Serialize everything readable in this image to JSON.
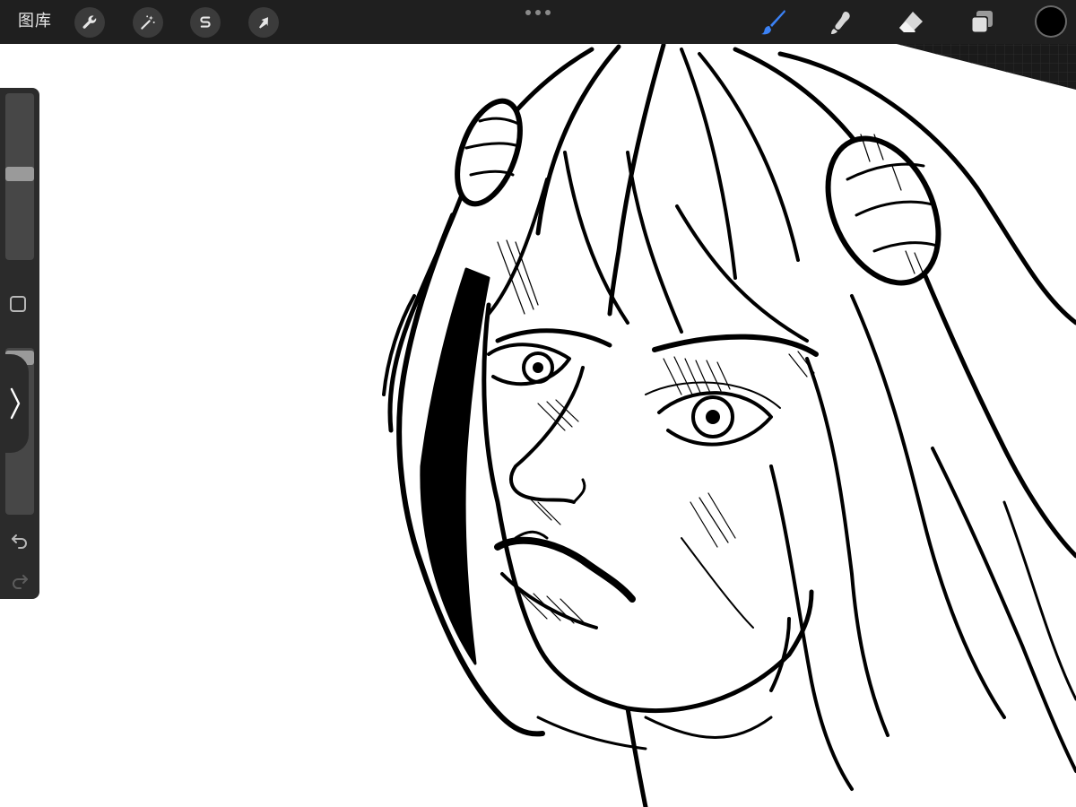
{
  "toolbar": {
    "gallery_label": "图库",
    "left_tools": [
      {
        "name": "actions",
        "icon": "wrench-icon"
      },
      {
        "name": "adjustments",
        "icon": "magic-wand-icon"
      },
      {
        "name": "selection",
        "icon": "selection-s-icon"
      },
      {
        "name": "transform",
        "icon": "arrow-cursor-icon"
      }
    ],
    "right_tools": [
      {
        "name": "brush",
        "icon": "brush-icon",
        "active": true
      },
      {
        "name": "smudge",
        "icon": "smudge-icon"
      },
      {
        "name": "eraser",
        "icon": "eraser-icon"
      },
      {
        "name": "layers",
        "icon": "layers-icon"
      }
    ],
    "active_color": "#000000",
    "accent_color": "#3b82f6"
  },
  "sidebar": {
    "brush_size_level": 0.52,
    "brush_opacity_level": 0.98
  }
}
